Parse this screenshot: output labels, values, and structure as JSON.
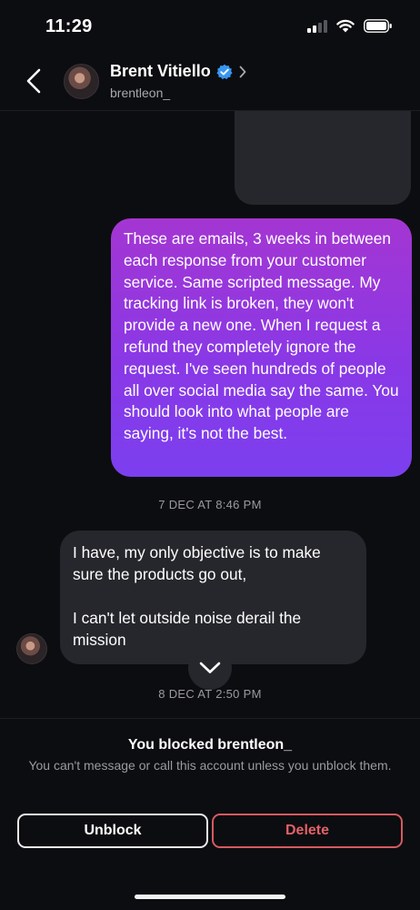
{
  "status_bar": {
    "time": "11:29"
  },
  "header": {
    "name": "Brent Vitiello",
    "handle": "brentleon_",
    "verified_color": "#3897f0"
  },
  "messages": {
    "outgoing_text": "These are emails, 3 weeks in between each response from your customer service. Same scripted message. My tracking link is broken, they won't provide a new one. When I request a refund they completely ignore the request. I've seen hundreds of people all over social media say the same. You should look into what people are saying, it's not the best.",
    "timestamp_1": "7 DEC AT 8:46 PM",
    "incoming_para_1": "I have, my only objective is to make sure the products go out,",
    "incoming_para_2": "I can't let outside noise derail the mission",
    "timestamp_2": "8 DEC AT 2:50 PM"
  },
  "blocked": {
    "title": "You blocked brentleon_",
    "description": "You can't message or call this account unless you unblock them.",
    "unblock_label": "Unblock",
    "delete_label": "Delete"
  },
  "colors": {
    "outgoing_bubble_top": "#a436d2",
    "outgoing_bubble_bottom": "#7b3fef",
    "incoming_bubble": "#26272c",
    "delete_accent": "#e26068"
  }
}
